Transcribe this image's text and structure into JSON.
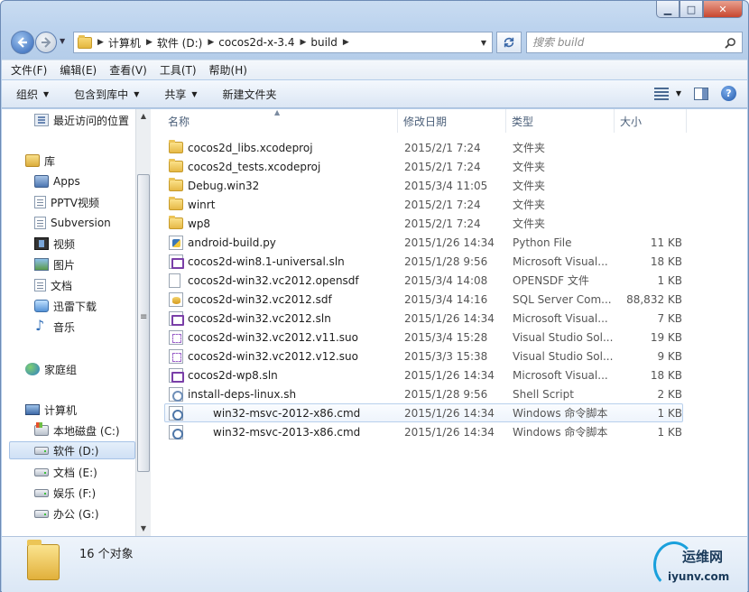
{
  "window": {
    "min_label": "▁",
    "max_label": "□",
    "close_label": "✕"
  },
  "address": {
    "crumbs": [
      "计算机",
      "软件 (D:)",
      "cocos2d-x-3.4",
      "build"
    ]
  },
  "search": {
    "placeholder": "搜索 build"
  },
  "menu": [
    "文件(F)",
    "编辑(E)",
    "查看(V)",
    "工具(T)",
    "帮助(H)"
  ],
  "commands": {
    "organize": "组织",
    "include_library": "包含到库中",
    "share": "共享",
    "new_folder": "新建文件夹"
  },
  "navpane": {
    "recent": "最近访问的位置",
    "libraries": "库",
    "apps": "Apps",
    "pptv": "PPTV视频",
    "subversion": "Subversion",
    "video": "视频",
    "pictures": "图片",
    "documents": "文档",
    "thunder": "迅雷下载",
    "music": "音乐",
    "homegroup": "家庭组",
    "computer": "计算机",
    "drive_c": "本地磁盘 (C:)",
    "drive_d": "软件 (D:)",
    "drive_e": "文档 (E:)",
    "drive_f": "娱乐 (F:)",
    "drive_g": "办公 (G:)"
  },
  "columns": {
    "name": "名称",
    "date": "修改日期",
    "type": "类型",
    "size": "大小"
  },
  "files": [
    {
      "name": "cocos2d_libs.xcodeproj",
      "date": "2015/2/1 7:24",
      "type": "文件夹",
      "size": "",
      "icon": "folder"
    },
    {
      "name": "cocos2d_tests.xcodeproj",
      "date": "2015/2/1 7:24",
      "type": "文件夹",
      "size": "",
      "icon": "folder"
    },
    {
      "name": "Debug.win32",
      "date": "2015/3/4 11:05",
      "type": "文件夹",
      "size": "",
      "icon": "folder"
    },
    {
      "name": "winrt",
      "date": "2015/2/1 7:24",
      "type": "文件夹",
      "size": "",
      "icon": "folder"
    },
    {
      "name": "wp8",
      "date": "2015/2/1 7:24",
      "type": "文件夹",
      "size": "",
      "icon": "folder"
    },
    {
      "name": "android-build.py",
      "date": "2015/1/26 14:34",
      "type": "Python File",
      "size": "11 KB",
      "icon": "py"
    },
    {
      "name": "cocos2d-win8.1-universal.sln",
      "date": "2015/1/28 9:56",
      "type": "Microsoft Visual...",
      "size": "18 KB",
      "icon": "sln"
    },
    {
      "name": "cocos2d-win32.vc2012.opensdf",
      "date": "2015/3/4 14:08",
      "type": "OPENSDF 文件",
      "size": "1 KB",
      "icon": "blank"
    },
    {
      "name": "cocos2d-win32.vc2012.sdf",
      "date": "2015/3/4 14:16",
      "type": "SQL Server Com...",
      "size": "88,832 KB",
      "icon": "sdf"
    },
    {
      "name": "cocos2d-win32.vc2012.sln",
      "date": "2015/1/26 14:34",
      "type": "Microsoft Visual...",
      "size": "7 KB",
      "icon": "sln"
    },
    {
      "name": "cocos2d-win32.vc2012.v11.suo",
      "date": "2015/3/4 15:28",
      "type": "Visual Studio Sol...",
      "size": "19 KB",
      "icon": "suo"
    },
    {
      "name": "cocos2d-win32.vc2012.v12.suo",
      "date": "2015/3/3 15:38",
      "type": "Visual Studio Sol...",
      "size": "9 KB",
      "icon": "suo"
    },
    {
      "name": "cocos2d-wp8.sln",
      "date": "2015/1/26 14:34",
      "type": "Microsoft Visual...",
      "size": "18 KB",
      "icon": "sln"
    },
    {
      "name": "install-deps-linux.sh",
      "date": "2015/1/28 9:56",
      "type": "Shell Script",
      "size": "2 KB",
      "icon": "sh"
    },
    {
      "name": "win32-msvc-2012-x86.cmd",
      "date": "2015/1/26 14:34",
      "type": "Windows 命令脚本",
      "size": "1 KB",
      "icon": "cmd"
    },
    {
      "name": "win32-msvc-2013-x86.cmd",
      "date": "2015/1/26 14:34",
      "type": "Windows 命令脚本",
      "size": "1 KB",
      "icon": "cmd"
    }
  ],
  "details": {
    "count": "16 个对象"
  },
  "watermark": {
    "cn": "运维网",
    "en": "iyunv.com"
  }
}
